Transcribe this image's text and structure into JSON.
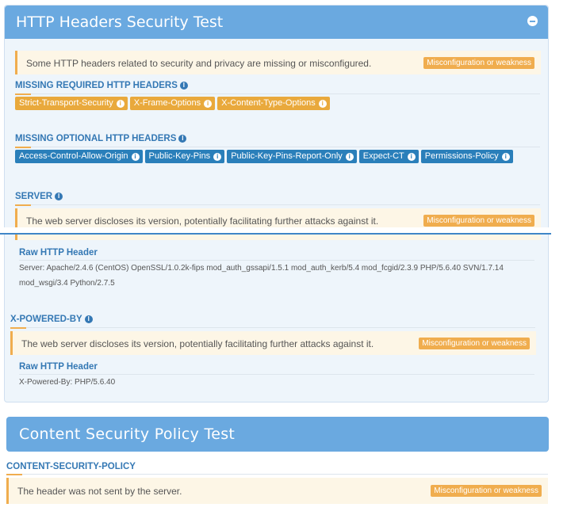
{
  "panel1": {
    "title": "HTTP Headers Security Test",
    "summary_alert": {
      "message": "Some HTTP headers related to security and privacy are missing or misconfigured.",
      "badge": "Misconfiguration or weakness"
    },
    "missing_required": {
      "title": "MISSING REQUIRED HTTP HEADERS",
      "tags": [
        "Strict-Transport-Security",
        "X-Frame-Options",
        "X-Content-Type-Options"
      ]
    },
    "missing_optional": {
      "title": "MISSING OPTIONAL HTTP HEADERS",
      "tags": [
        "Access-Control-Allow-Origin",
        "Public-Key-Pins",
        "Public-Key-Pins-Report-Only",
        "Expect-CT",
        "Permissions-Policy"
      ]
    },
    "server": {
      "title": "SERVER",
      "alert": {
        "message": "The web server discloses its version, potentially facilitating further attacks against it.",
        "badge": "Misconfiguration or weakness"
      },
      "raw_title": "Raw HTTP Header",
      "raw_line1": "Server: Apache/2.4.6 (CentOS) OpenSSL/1.0.2k-fips mod_auth_gssapi/1.5.1 mod_auth_kerb/5.4 mod_fcgid/2.3.9 PHP/5.6.40 SVN/1.7.14",
      "raw_line2": "mod_wsgi/3.4 Python/2.7.5"
    },
    "x_powered_by": {
      "title": "X-POWERED-BY",
      "alert": {
        "message": "The web server discloses its version, potentially facilitating further attacks against it.",
        "badge": "Misconfiguration or weakness"
      },
      "raw_title": "Raw HTTP Header",
      "raw_value": "X-Powered-By: PHP/5.6.40"
    }
  },
  "panel2": {
    "title": "Content Security Policy Test",
    "csp": {
      "title": "CONTENT-SECURITY-POLICY",
      "alert": {
        "message": "The header was not sent by the server.",
        "badge": "Misconfiguration or weakness"
      }
    }
  },
  "colors": {
    "header_bar": "#6aa9e0",
    "warning": "#f0ad4e",
    "info_tag": "#2a7fba",
    "section_title": "#3478b4"
  }
}
